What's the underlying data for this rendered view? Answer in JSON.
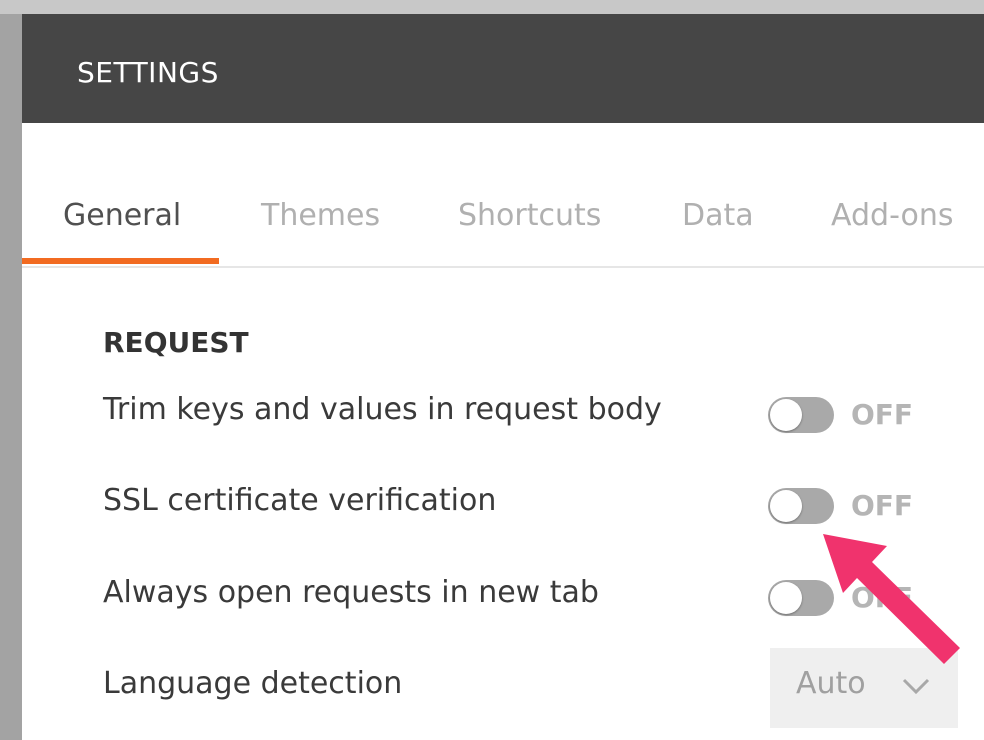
{
  "modal": {
    "title": "SETTINGS"
  },
  "tabs": [
    {
      "label": "General",
      "active": true
    },
    {
      "label": "Themes",
      "active": false
    },
    {
      "label": "Shortcuts",
      "active": false
    },
    {
      "label": "Data",
      "active": false
    },
    {
      "label": "Add-ons",
      "active": false
    }
  ],
  "section": {
    "heading": "REQUEST",
    "rows": [
      {
        "label": "Trim keys and values in request body",
        "state": "OFF"
      },
      {
        "label": "SSL certificate verification",
        "state": "OFF"
      },
      {
        "label": "Always open requests in new tab",
        "state": "OFF"
      },
      {
        "label": "Language detection",
        "select_value": "Auto"
      }
    ]
  },
  "colors": {
    "header_bg": "#464646",
    "accent": "#f26b21",
    "annotation_arrow": "#f0336d"
  },
  "icons": {
    "chevron": "chevron-down-icon",
    "annotation": "annotation-arrow"
  }
}
